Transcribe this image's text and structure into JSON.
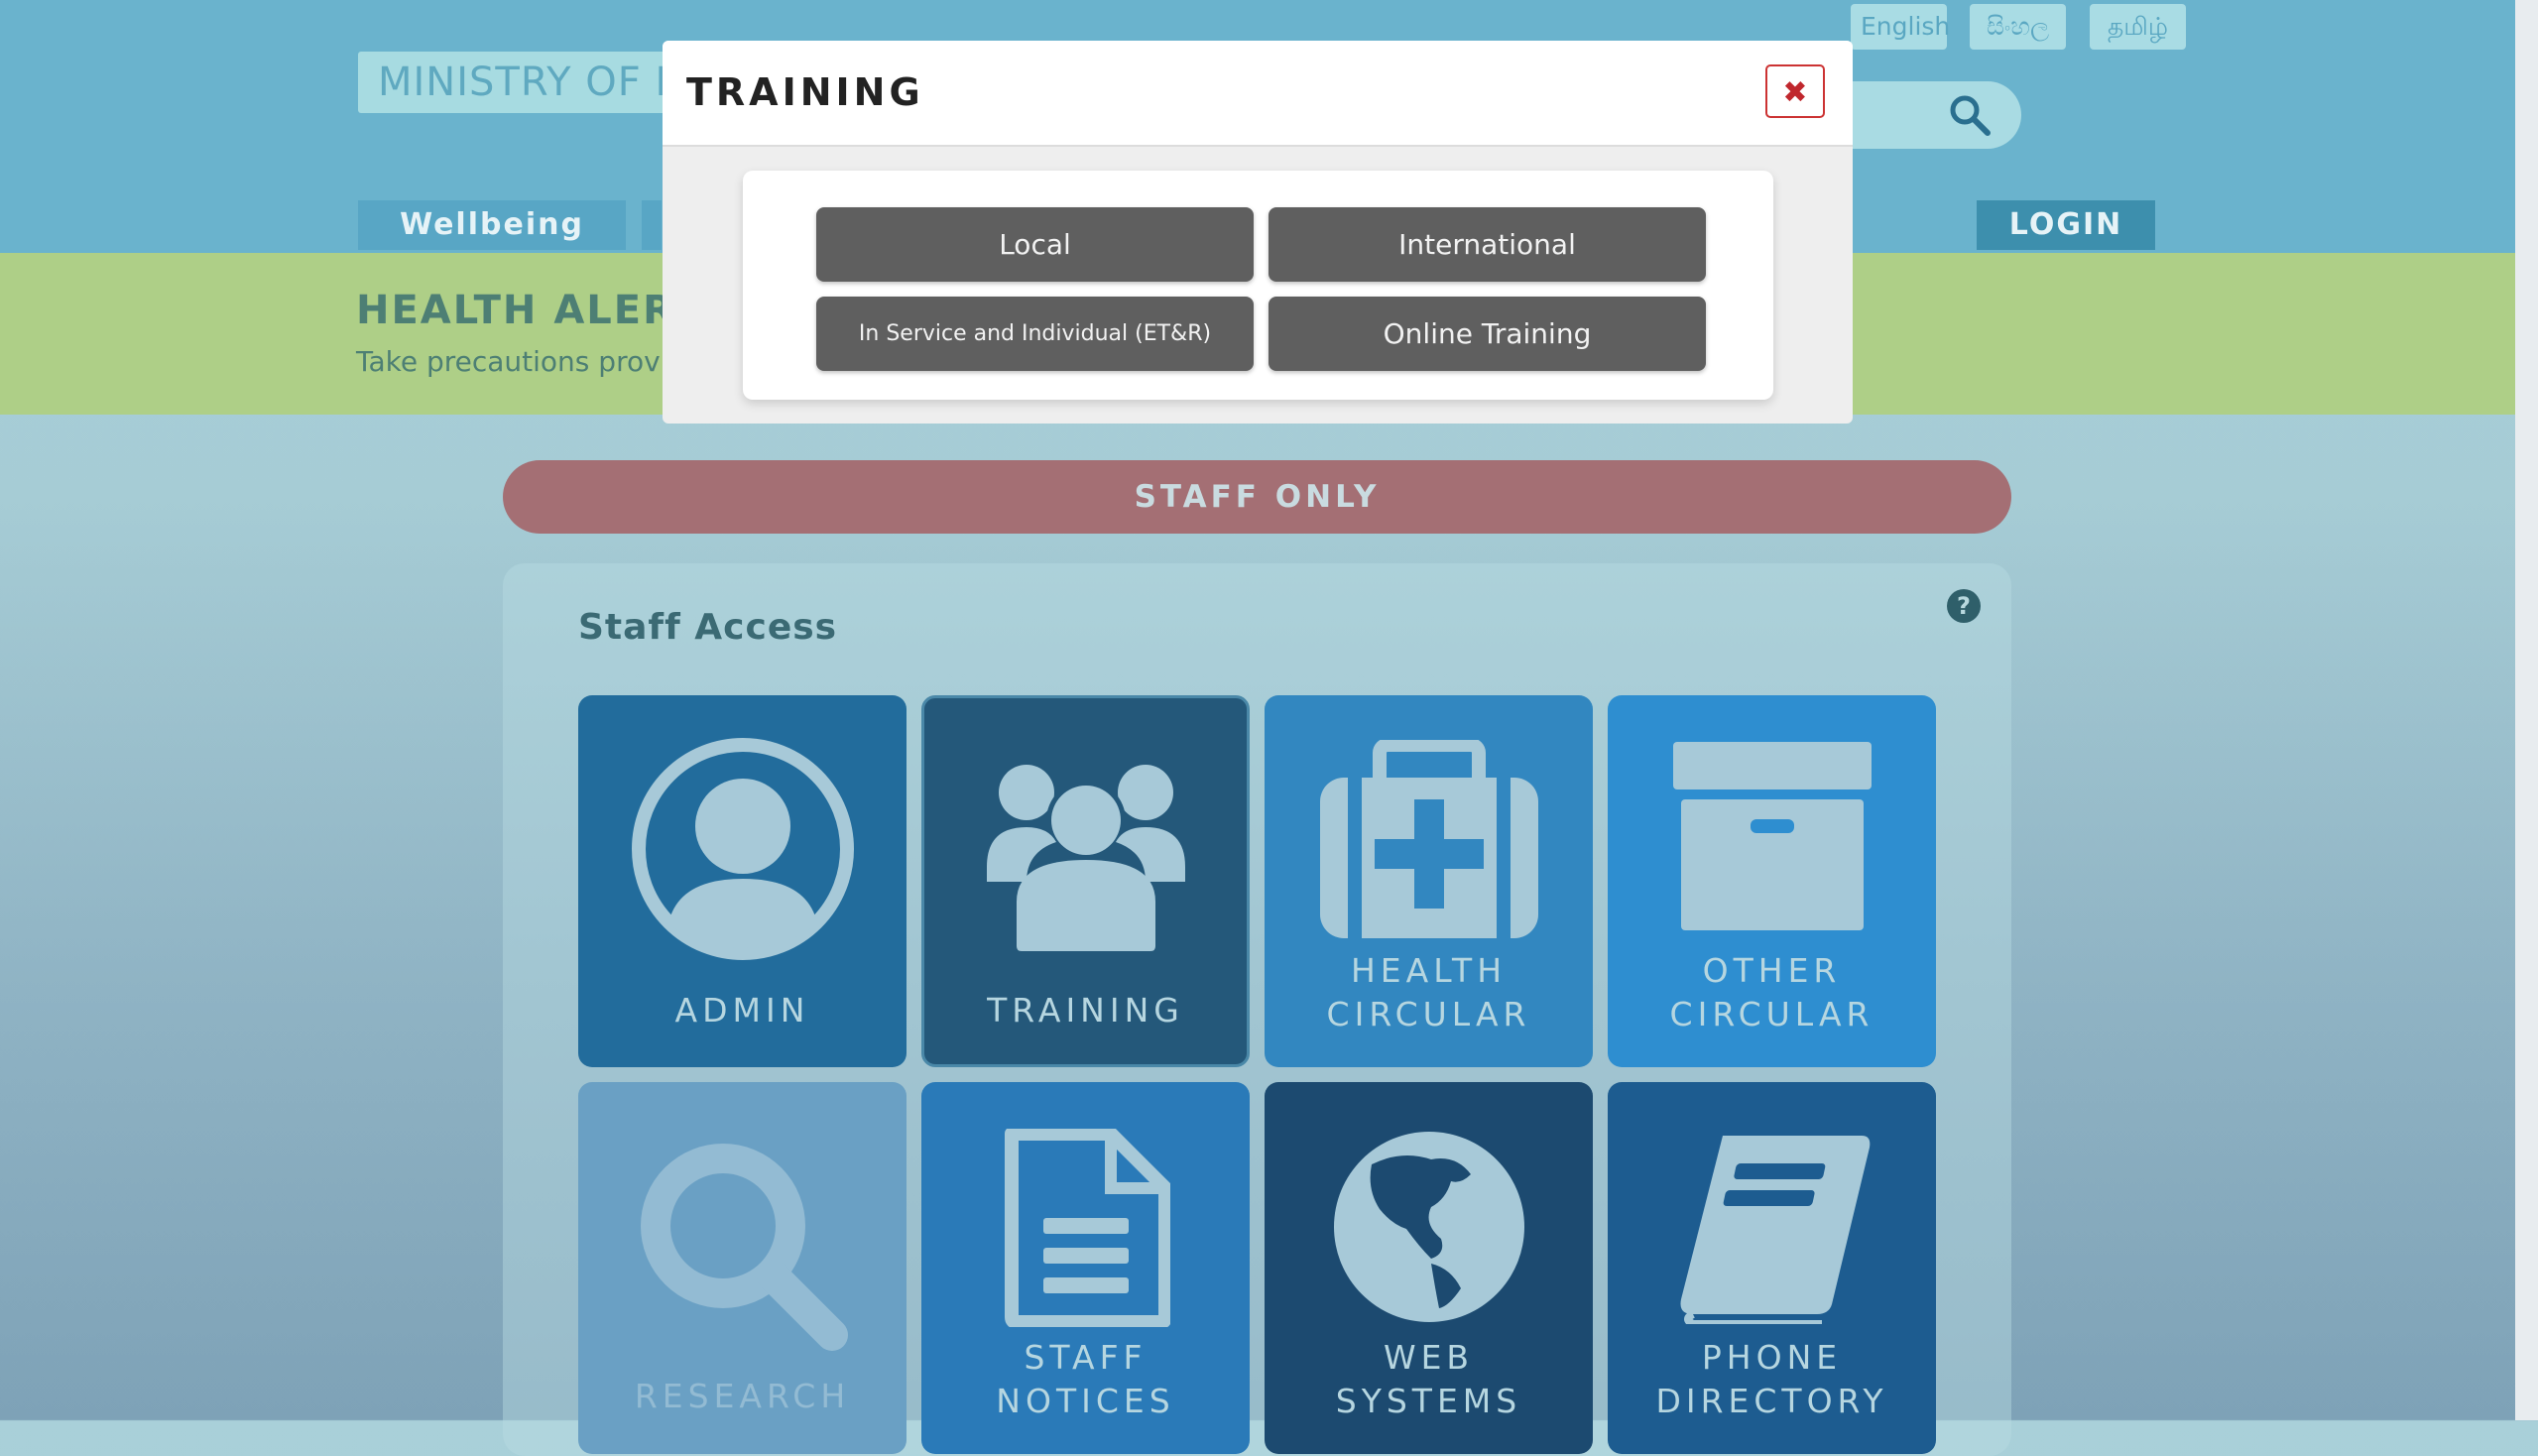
{
  "header": {
    "logo_text": "MINISTRY OF H",
    "languages": [
      "English",
      "සිංහල",
      "தமிழ்"
    ],
    "nav": {
      "wellbeing": "Wellbeing",
      "login": "LOGIN"
    }
  },
  "alert": {
    "title": "HEALTH ALERT",
    "text": "Take precautions prov"
  },
  "staff_only": "STAFF ONLY",
  "panel": {
    "title": "Staff Access",
    "help": "?",
    "tiles": [
      {
        "label": "ADMIN",
        "icon": "user-circle-icon",
        "color": "#226c9c"
      },
      {
        "label": "TRAINING",
        "icon": "users-group-icon",
        "color": "#24587a"
      },
      {
        "label": [
          "HEALTH",
          "CIRCULAR"
        ],
        "icon": "medical-kit-icon",
        "color": "#3287c0"
      },
      {
        "label": [
          "OTHER",
          "CIRCULAR"
        ],
        "icon": "archive-box-icon",
        "color": "#2e8ed0"
      },
      {
        "label": "RESEARCH",
        "icon": "search-icon",
        "color": "#6aa0c4"
      },
      {
        "label": [
          "STAFF",
          "NOTICES"
        ],
        "icon": "document-icon",
        "color": "#2a7ab8"
      },
      {
        "label": [
          "WEB",
          "SYSTEMS"
        ],
        "icon": "globe-icon",
        "color": "#1c4a70"
      },
      {
        "label": [
          "PHONE",
          "DIRECTORY"
        ],
        "icon": "book-icon",
        "color": "#1d5c90"
      }
    ]
  },
  "modal": {
    "title": "TRAINING",
    "close": "✖",
    "buttons": [
      "Local",
      "International",
      "In Service and Individual (ET&R)",
      "Online Training"
    ]
  }
}
